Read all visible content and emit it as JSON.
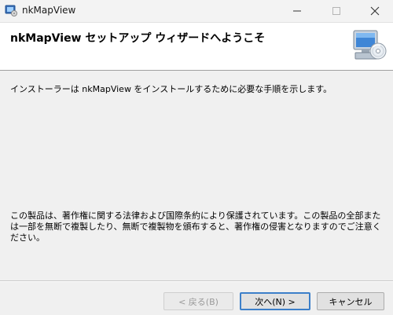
{
  "window": {
    "title": "nkMapView",
    "controls": {
      "minimize": "minimize",
      "maximize": "maximize",
      "close": "close"
    }
  },
  "header": {
    "title": "nkMapView セットアップ ウィザードへようこそ",
    "icon": "computer-cd-icon"
  },
  "content": {
    "intro": "インストーラーは nkMapView をインストールするために必要な手順を示します。",
    "copyright_notice": "この製品は、著作権に関する法律および国際条約により保護されています。この製品の全部または一部を無断で複製したり、無断で複製物を頒布すると、著作権の侵害となりますのでご注意ください。"
  },
  "buttons": {
    "back": "< 戻る(B)",
    "next": "次へ(N) >",
    "cancel": "キャンセル"
  },
  "colors": {
    "accent": "#3c7fc9",
    "background": "#f0f0f0"
  }
}
